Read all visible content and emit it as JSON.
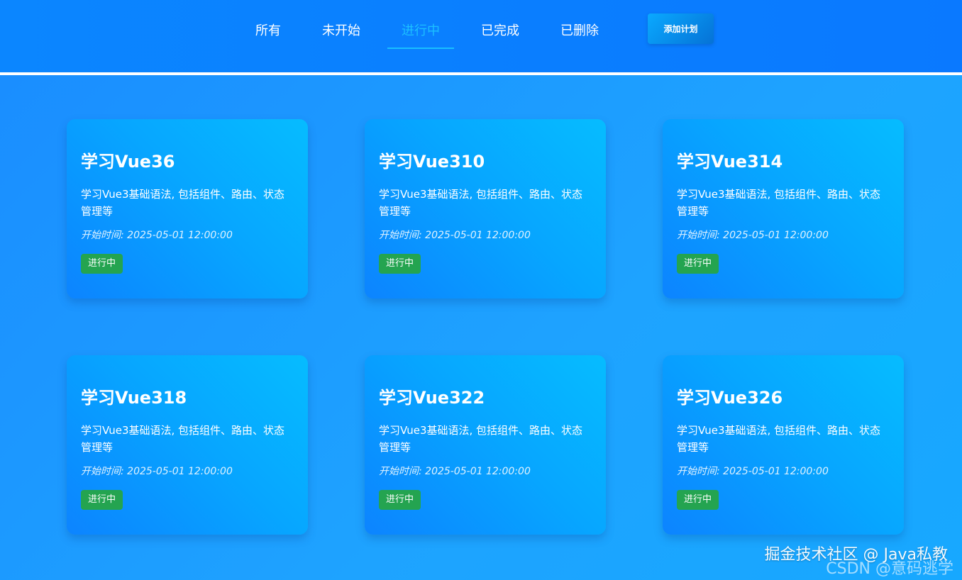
{
  "nav": {
    "tabs": [
      {
        "label": "所有"
      },
      {
        "label": "未开始"
      },
      {
        "label": "进行中"
      },
      {
        "label": "已完成"
      },
      {
        "label": "已删除"
      }
    ],
    "active_tab": "进行中",
    "add_button": "添加计划"
  },
  "cards": [
    {
      "title": "学习Vue36",
      "desc": "学习Vue3基础语法, 包括组件、路由、状态管理等",
      "time": "开始时间: 2025-05-01 12:00:00",
      "status": "进行中"
    },
    {
      "title": "学习Vue310",
      "desc": "学习Vue3基础语法, 包括组件、路由、状态管理等",
      "time": "开始时间: 2025-05-01 12:00:00",
      "status": "进行中"
    },
    {
      "title": "学习Vue314",
      "desc": "学习Vue3基础语法, 包括组件、路由、状态管理等",
      "time": "开始时间: 2025-05-01 12:00:00",
      "status": "进行中"
    },
    {
      "title": "学习Vue318",
      "desc": "学习Vue3基础语法, 包括组件、路由、状态管理等",
      "time": "开始时间: 2025-05-01 12:00:00",
      "status": "进行中"
    },
    {
      "title": "学习Vue322",
      "desc": "学习Vue3基础语法, 包括组件、路由、状态管理等",
      "time": "开始时间: 2025-05-01 12:00:00",
      "status": "进行中"
    },
    {
      "title": "学习Vue326",
      "desc": "学习Vue3基础语法, 包括组件、路由、状态管理等",
      "time": "开始时间: 2025-05-01 12:00:00",
      "status": "进行中"
    }
  ],
  "watermark": {
    "line1": "掘金技术社区 @ Java私教",
    "line2": "CSDN @意码逃学"
  },
  "colors": {
    "header_bg": "#0a7fff",
    "active_tab": "#1cc0ff",
    "status_badge": "#24a450"
  }
}
